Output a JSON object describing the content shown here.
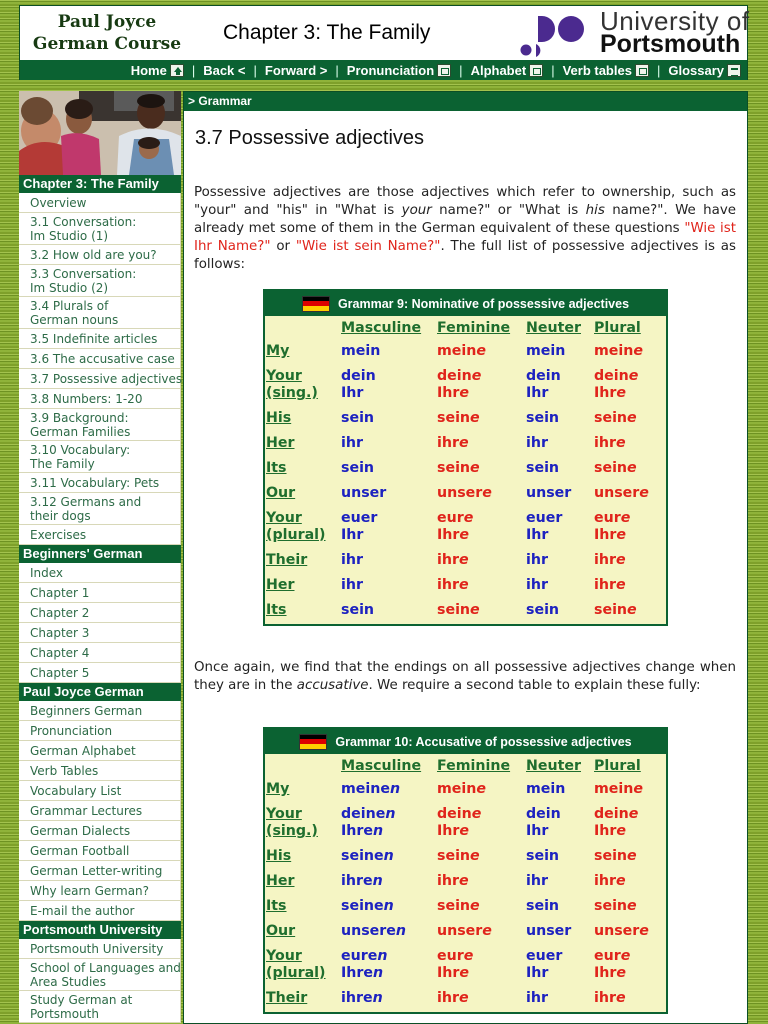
{
  "header": {
    "brand_line1": "Paul Joyce",
    "brand_line2": "German Course",
    "chapter_title": "Chapter 3: The Family",
    "logo_line1": "University of",
    "logo_line2": "Portsmouth",
    "logo_color": "#4b2a8f"
  },
  "navbar": {
    "items": [
      {
        "label": "Home",
        "icon": "home-icon"
      },
      {
        "label": "Back <",
        "icon": null
      },
      {
        "label": "Forward >",
        "icon": null
      },
      {
        "label": "Pronunciation",
        "icon": "pronunciation-icon"
      },
      {
        "label": "Alphabet",
        "icon": "alphabet-icon"
      },
      {
        "label": "Verb tables",
        "icon": "verb-tables-icon"
      },
      {
        "label": "Glossary",
        "icon": "glossary-icon"
      }
    ]
  },
  "sidebar": {
    "photo_alt": "family-photo",
    "sections": [
      {
        "title": "Chapter 3: The Family",
        "items": [
          "Overview",
          "3.1 Conversation:\nIm Studio (1)",
          "3.2 How old are you?",
          "3.3 Conversation:\nIm Studio (2)",
          "3.4 Plurals of\nGerman nouns",
          "3.5 Indefinite articles",
          "3.6 The accusative case",
          "3.7 Possessive adjectives",
          "3.8 Numbers: 1-20",
          "3.9 Background:\nGerman Families",
          "3.10 Vocabulary:\nThe Family",
          "3.11 Vocabulary: Pets",
          "3.12 Germans and\ntheir dogs",
          "Exercises"
        ]
      },
      {
        "title": "Beginners' German",
        "items": [
          "Index",
          "Chapter 1",
          "Chapter 2",
          "Chapter 3",
          "Chapter 4",
          "Chapter 5"
        ]
      },
      {
        "title": "Paul Joyce German",
        "items": [
          "Beginners German",
          "Pronunciation",
          "German Alphabet",
          "Verb Tables",
          "Vocabulary List",
          "Grammar Lectures",
          "German Dialects",
          "German Football",
          "German Letter-writing",
          "Why learn German?",
          "E-mail the author"
        ]
      },
      {
        "title": "Portsmouth University",
        "items": [
          "Portsmouth University",
          "School of Languages and\nArea Studies",
          "Study German at\nPortsmouth"
        ]
      }
    ]
  },
  "content": {
    "breadcrumb": "> Grammar",
    "title": "3.7 Possessive adjectives",
    "intro": {
      "t1": "Possessive adjectives are those adjectives which refer to ownership, such as \"your\" and \"his\" in \"What is ",
      "i1": "your",
      "t2": " name?\" or \"What is ",
      "i2": "his",
      "t3": " name?\". We have already met some of them in the German equivalent of these questions ",
      "r1": "\"Wie ist Ihr Name?\"",
      "t4": " or ",
      "r2": "\"Wie ist sein Name?\"",
      "t5": ". The full list of possessive adjectives is as follows:"
    },
    "second_para": {
      "t1": "Once again, we find that the endings on all possessive adjectives change when they are in the ",
      "i1": "accusative",
      "t2": ". We require a second table to explain these fully:"
    },
    "flag_colors": [
      "#000000",
      "#dd0000",
      "#ffce00"
    ],
    "table_colors": {
      "masc_neut": "#1d22c0",
      "fem_plural": "#e0241b",
      "label": "#1f6e2e",
      "bg": "#f5f5c4",
      "header": "#0b6232"
    },
    "tables": [
      {
        "title": "Grammar 9: Nominative of possessive adjectives",
        "columns": [
          "Masculine",
          "Feminine",
          "Neuter",
          "Plural"
        ],
        "rows": [
          {
            "label": "My",
            "m": "mein",
            "f": "meine",
            "n": "mein",
            "p": "meine"
          },
          {
            "label": "Your\n(sing.)",
            "m": "dein\nIhr",
            "f": "deine\nIhre",
            "n": "dein\nIhr",
            "p": "deine\nIhre"
          },
          {
            "label": "His",
            "m": "sein",
            "f": "seine",
            "n": "sein",
            "p": "seine"
          },
          {
            "label": "Her",
            "m": "ihr",
            "f": "ihre",
            "n": "ihr",
            "p": "ihre"
          },
          {
            "label": "Its",
            "m": "sein",
            "f": "seine",
            "n": "sein",
            "p": "seine"
          },
          {
            "label": "Our",
            "m": "unser",
            "f": "unsere",
            "n": "unser",
            "p": "unsere"
          },
          {
            "label": "Your\n(plural)",
            "m": "euer\nIhr",
            "f": "eure\nIhre",
            "n": "euer\nIhr",
            "p": "eure\nIhre"
          },
          {
            "label": "Their",
            "m": "ihr",
            "f": "ihre",
            "n": "ihr",
            "p": "ihre"
          },
          {
            "label": "Her",
            "m": "ihr",
            "f": "ihre",
            "n": "ihr",
            "p": "ihre"
          },
          {
            "label": "Its",
            "m": "sein",
            "f": "seine",
            "n": "sein",
            "p": "seine"
          }
        ]
      },
      {
        "title": "Grammar 10: Accusative of possessive adjectives",
        "columns": [
          "Masculine",
          "Feminine",
          "Neuter",
          "Plural"
        ],
        "rows": [
          {
            "label": "My",
            "m": "meinen",
            "f": "meine",
            "n": "mein",
            "p": "meine"
          },
          {
            "label": "Your\n(sing.)",
            "m": "deinen\nIhren",
            "f": "deine\nIhre",
            "n": "dein\nIhr",
            "p": "deine\nIhre"
          },
          {
            "label": "His",
            "m": "seinen",
            "f": "seine",
            "n": "sein",
            "p": "seine"
          },
          {
            "label": "Her",
            "m": "ihren",
            "f": "ihre",
            "n": "ihr",
            "p": "ihre"
          },
          {
            "label": "Its",
            "m": "seinen",
            "f": "seine",
            "n": "sein",
            "p": "seine"
          },
          {
            "label": "Our",
            "m": "unseren",
            "f": "unsere",
            "n": "unser",
            "p": "unsere"
          },
          {
            "label": "Your\n(plural)",
            "m": "euren\nIhren",
            "f": "eure\nIhre",
            "n": "euer\nIhr",
            "p": "eure\nIhre"
          },
          {
            "label": "Their",
            "m": "ihren",
            "f": "ihre",
            "n": "ihr",
            "p": "ihre"
          }
        ]
      }
    ]
  }
}
